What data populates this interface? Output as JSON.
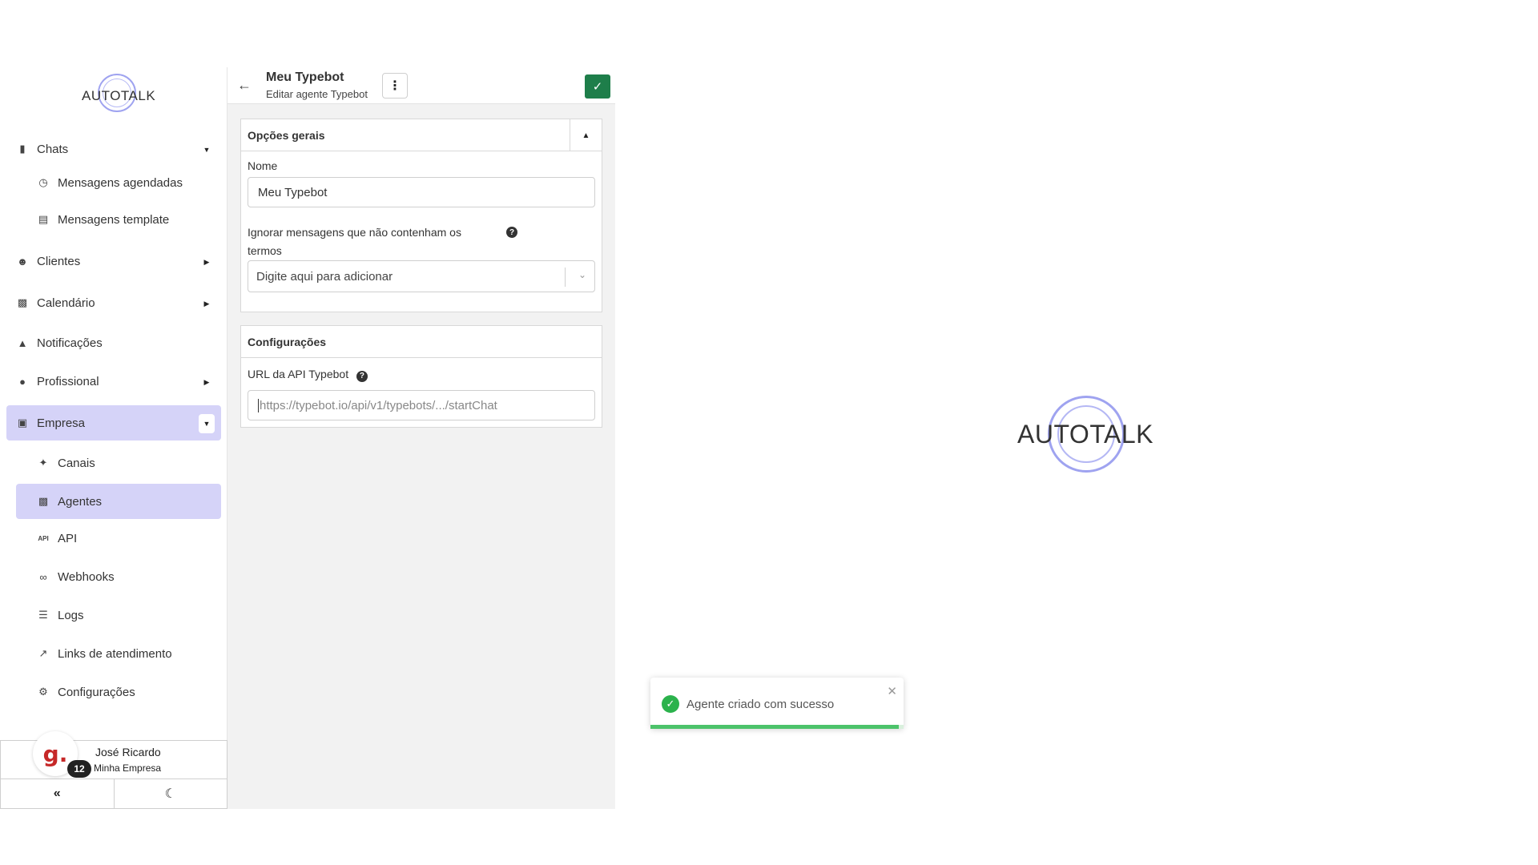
{
  "brand": {
    "name": "AUTOTALK"
  },
  "sidebar": {
    "items": [
      {
        "label": "Chats",
        "icon": "chat-icon",
        "caret": "down"
      },
      {
        "label": "Mensagens agendadas",
        "icon": "clock-icon",
        "sub": true
      },
      {
        "label": "Mensagens template",
        "icon": "template-icon",
        "sub": true
      },
      {
        "label": "Clientes",
        "icon": "users-icon",
        "caret": "right"
      },
      {
        "label": "Calendário",
        "icon": "calendar-icon",
        "caret": "right"
      },
      {
        "label": "Notificações",
        "icon": "bell-icon"
      },
      {
        "label": "Profissional",
        "icon": "user-gear-icon",
        "caret": "right"
      },
      {
        "label": "Empresa",
        "icon": "building-icon",
        "caret": "down",
        "active": true
      },
      {
        "label": "Canais",
        "icon": "plug-icon",
        "sub": true
      },
      {
        "label": "Agentes",
        "icon": "robot-icon",
        "sub": true,
        "active": true
      },
      {
        "label": "API",
        "icon": "api-icon",
        "sub": true
      },
      {
        "label": "Webhooks",
        "icon": "webhook-icon",
        "sub": true
      },
      {
        "label": "Logs",
        "icon": "list-icon",
        "sub": true
      },
      {
        "label": "Links de atendimento",
        "icon": "external-link-icon",
        "sub": true
      },
      {
        "label": "Configurações",
        "icon": "gear-icon",
        "sub": true
      }
    ],
    "user": {
      "avatar_letter": "g.",
      "badge_count": "12",
      "name": "José Ricardo",
      "company": "Minha Empresa"
    }
  },
  "header": {
    "title": "Meu Typebot",
    "subtitle": "Editar agente Typebot"
  },
  "general": {
    "title": "Opções gerais",
    "name_label": "Nome",
    "name_value": "Meu Typebot",
    "ignore_label_1": "Ignorar mensagens que não contenham os",
    "ignore_label_2": "termos",
    "ignore_placeholder": "Digite aqui para adicionar"
  },
  "settings": {
    "title": "Configurações",
    "url_label": "URL da API Typebot",
    "url_placeholder": "https://typebot.io/api/v1/typebots/.../startChat"
  },
  "toast": {
    "message": "Agente criado com sucesso",
    "progress": 0.98,
    "color": "#2bb24c"
  },
  "colors": {
    "accent": "#d5d3f8",
    "save": "#1e7e4a",
    "logo_ring": "#9fa3f0"
  }
}
